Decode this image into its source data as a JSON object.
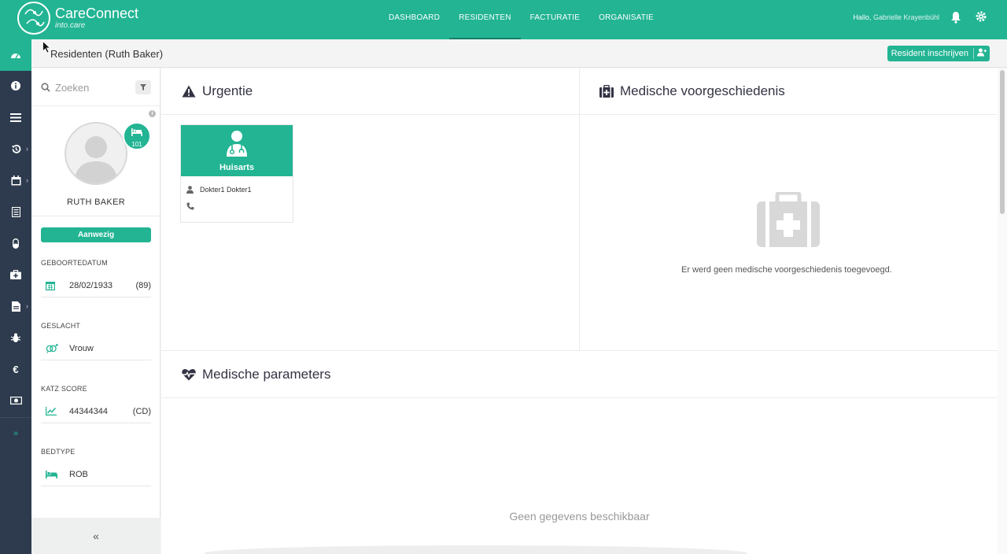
{
  "app": {
    "name": "CareConnect",
    "subtitle": "into.care",
    "brand_color": "#22b493",
    "nav_dark": "#2e3b4e"
  },
  "topnav": {
    "items": [
      {
        "label": "DASHBOARD"
      },
      {
        "label": "RESIDENTEN"
      },
      {
        "label": "FACTURATIE"
      },
      {
        "label": "ORGANISATIE"
      }
    ],
    "active": "RESIDENTEN",
    "greeting": "Hallo,",
    "user": "Gabrielle Krayenbühl",
    "icons": [
      "bell-icon",
      "gear-icon"
    ]
  },
  "leftrail": {
    "icons": [
      "dashboard-icon",
      "info-icon",
      "list-icon",
      "history-icon",
      "calendar-icon",
      "document-list-icon",
      "pill-icon",
      "medical-kit-icon",
      "file-icon",
      "bug-icon",
      "euro-icon",
      "money-icon",
      "expand-icon"
    ]
  },
  "subheader": {
    "title": "Residenten (Ruth Baker)",
    "enroll_button": "Resident inschrijven"
  },
  "sidebar": {
    "search_placeholder": "Zoeken",
    "bed_number": "101",
    "resident_name": "RUTH BAKER",
    "status": "Aanwezig",
    "fields": {
      "birthdate_label": "GEBOORTEDATUM",
      "birthdate": "28/02/1933",
      "age": "(89)",
      "gender_label": "GESLACHT",
      "gender": "Vrouw",
      "katz_label": "KATZ SCORE",
      "katz": "44344344",
      "katz_code": "(CD)",
      "bedtype_label": "BEDTYPE",
      "bedtype": "ROB"
    },
    "collapse": "«"
  },
  "urgency": {
    "title": "Urgentie",
    "card": {
      "role": "Huisarts",
      "name": "Dokter1 Dokter1",
      "phone": ""
    }
  },
  "medical_history": {
    "title": "Medische voorgeschiedenis",
    "empty": "Er werd geen medische voorgeschiedenis toegevoegd."
  },
  "parameters": {
    "title": "Medische parameters",
    "empty": "Geen gegevens beschikbaar"
  }
}
